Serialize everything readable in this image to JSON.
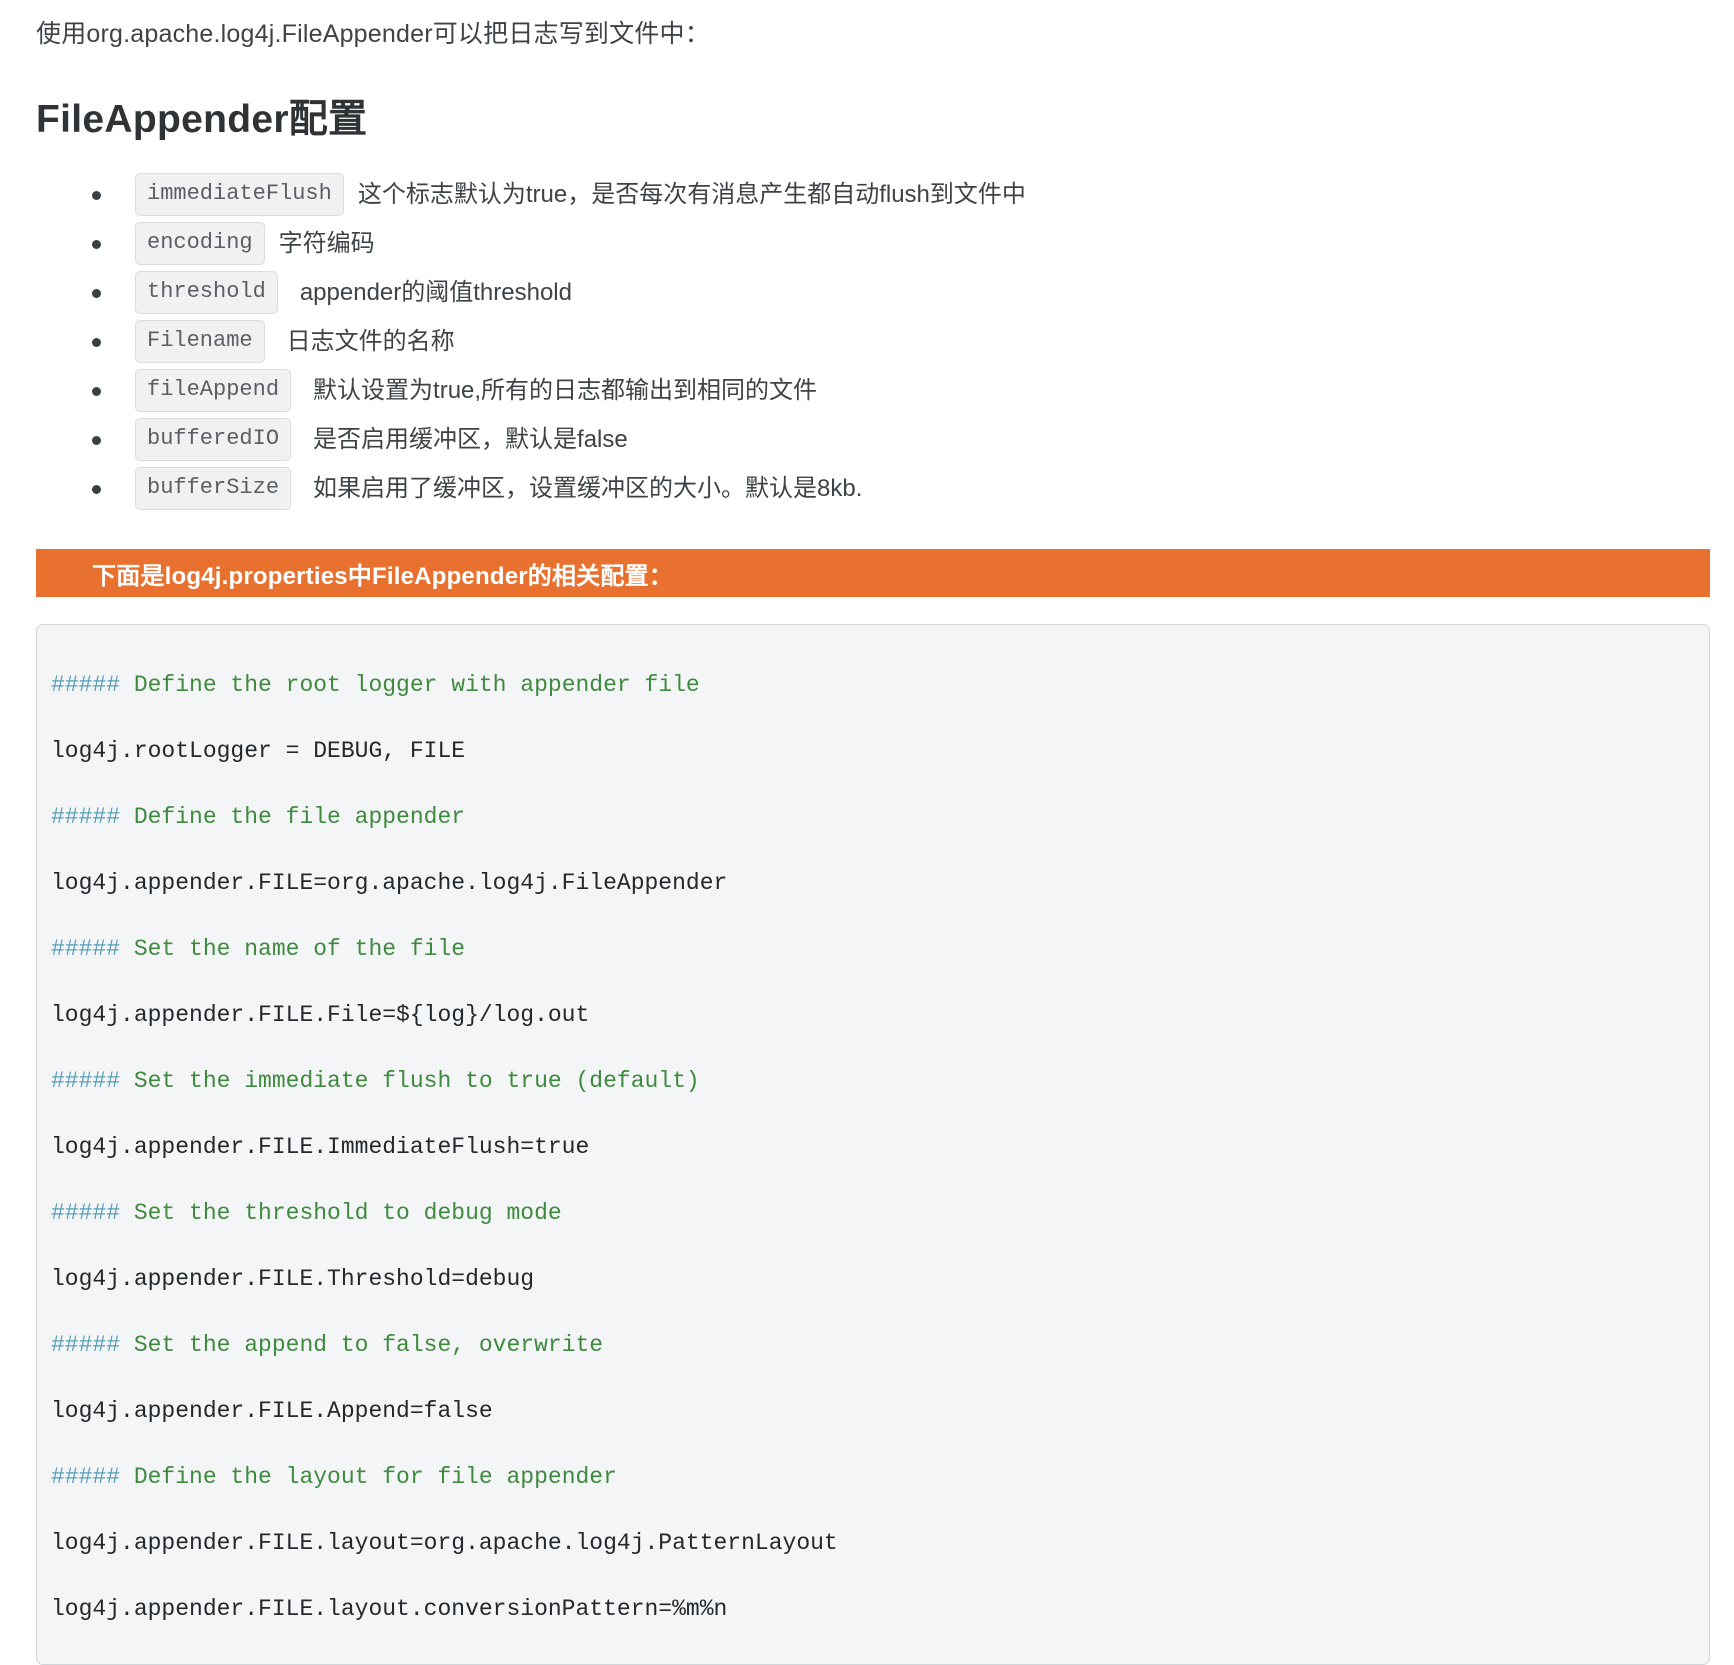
{
  "intro": {
    "text": "使用org.apache.log4j.FileAppender可以把日志写到文件中："
  },
  "heading": {
    "title": "FileAppender配置"
  },
  "properties": [
    {
      "name": "immediateFlush",
      "desc": "这个标志默认为true，是否每次有消息产生都自动flush到文件中"
    },
    {
      "name": "encoding",
      "desc": "字符编码"
    },
    {
      "name": "threshold",
      "desc": "appender的阈值threshold"
    },
    {
      "name": "Filename",
      "desc": "日志文件的名称"
    },
    {
      "name": "fileAppend",
      "desc": "默认设置为true,所有的日志都输出到相同的文件"
    },
    {
      "name": "bufferedIO",
      "desc": "是否启用缓冲区，默认是false"
    },
    {
      "name": "bufferSize",
      "desc": "如果启用了缓冲区，设置缓冲区的大小。默认是8kb."
    }
  ],
  "banner": {
    "text": "下面是log4j.properties中FileAppender的相关配置：",
    "background_color": "#e8712f",
    "text_color": "#ffffff"
  },
  "code_block": {
    "background_color": "#f4f5f6",
    "border_color": "#d3d6d9",
    "hash_color": "#5a9fb8",
    "comment_color": "#3f8a3f",
    "text_color": "#23282c",
    "lines": [
      {
        "type": "comment",
        "hash": "#####",
        "text": " Define the root logger with appender file"
      },
      {
        "type": "code",
        "text": "log4j.rootLogger = DEBUG, FILE"
      },
      {
        "type": "comment",
        "hash": "#####",
        "text": " Define the file appender"
      },
      {
        "type": "code",
        "text": "log4j.appender.FILE=org.apache.log4j.FileAppender"
      },
      {
        "type": "comment",
        "hash": "#####",
        "text": " Set the name of the file"
      },
      {
        "type": "code",
        "text": "log4j.appender.FILE.File=${log}/log.out"
      },
      {
        "type": "comment",
        "hash": "#####",
        "text": " Set the immediate flush to true (default)"
      },
      {
        "type": "code",
        "text": "log4j.appender.FILE.ImmediateFlush=true"
      },
      {
        "type": "comment",
        "hash": "#####",
        "text": " Set the threshold to debug mode"
      },
      {
        "type": "code",
        "text": "log4j.appender.FILE.Threshold=debug"
      },
      {
        "type": "comment",
        "hash": "#####",
        "text": " Set the append to false, overwrite"
      },
      {
        "type": "code",
        "text": "log4j.appender.FILE.Append=false"
      },
      {
        "type": "comment",
        "hash": "#####",
        "text": " Define the layout for file appender"
      },
      {
        "type": "code",
        "text": "log4j.appender.FILE.layout=org.apache.log4j.PatternLayout"
      },
      {
        "type": "code",
        "text": "log4j.appender.FILE.layout.conversionPattern=%m%n"
      }
    ]
  }
}
